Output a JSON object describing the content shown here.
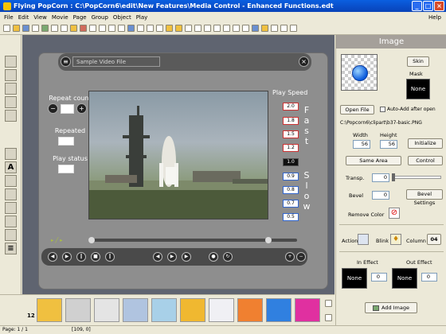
{
  "window": {
    "title": "Flying PopCorn : C:\\PopCorn6\\edit\\New Features\\Media Control - Enhanced Functions.edt"
  },
  "menu": [
    "File",
    "Edit",
    "View",
    "Movie",
    "Page",
    "Group",
    "Object",
    "Play"
  ],
  "menu_help": "Help",
  "player": {
    "file_label": "Sample Video File",
    "repeat_count_label": "Repeat count",
    "repeated_label": "Repeated",
    "play_status_label": "Play status",
    "play_speed_label": "Play Speed",
    "speed_values": [
      "2.0",
      "1.8",
      "1.5",
      "1.2",
      "1.0",
      "0.9",
      "0.8",
      "0.7",
      "0.5"
    ],
    "fast_letters": [
      "F",
      "a",
      "s",
      "t"
    ],
    "slow_letters": [
      "S",
      "l",
      "o",
      "w"
    ]
  },
  "bottom": {
    "count": "12"
  },
  "status": {
    "page": "Page: 1 / 1",
    "coords": "[109, 0]"
  },
  "panel": {
    "title": "Image",
    "skin_button": "Skin",
    "mask_label": "Mask",
    "mask_value": "None",
    "open_file_button": "Open File",
    "auto_add_label": "Auto-Add after open",
    "file_path": "C:\\Popcorn6\\clipart\\b37-basic.PNG",
    "width_label": "Width",
    "height_label": "Height",
    "width_value": "56",
    "height_value": "56",
    "initialize_button": "Initialize",
    "same_area_button": "Same Area",
    "control_button": "Control",
    "transp_label": "Transp.",
    "transp_value": "0",
    "bevel_label": "Bevel",
    "bevel_value": "0",
    "bevel_settings_button": "Bevel Settings",
    "remove_color_label": "Remove Color",
    "action_label": "Action",
    "blink_label": "Blink",
    "column_label": "Column",
    "column_value": "04",
    "in_effect_label": "In Effect",
    "out_effect_label": "Out Effect",
    "in_effect_value": "None",
    "out_effect_value": "None",
    "in_effect_num": "0",
    "out_effect_num": "0",
    "add_image_button": "Add Image"
  }
}
